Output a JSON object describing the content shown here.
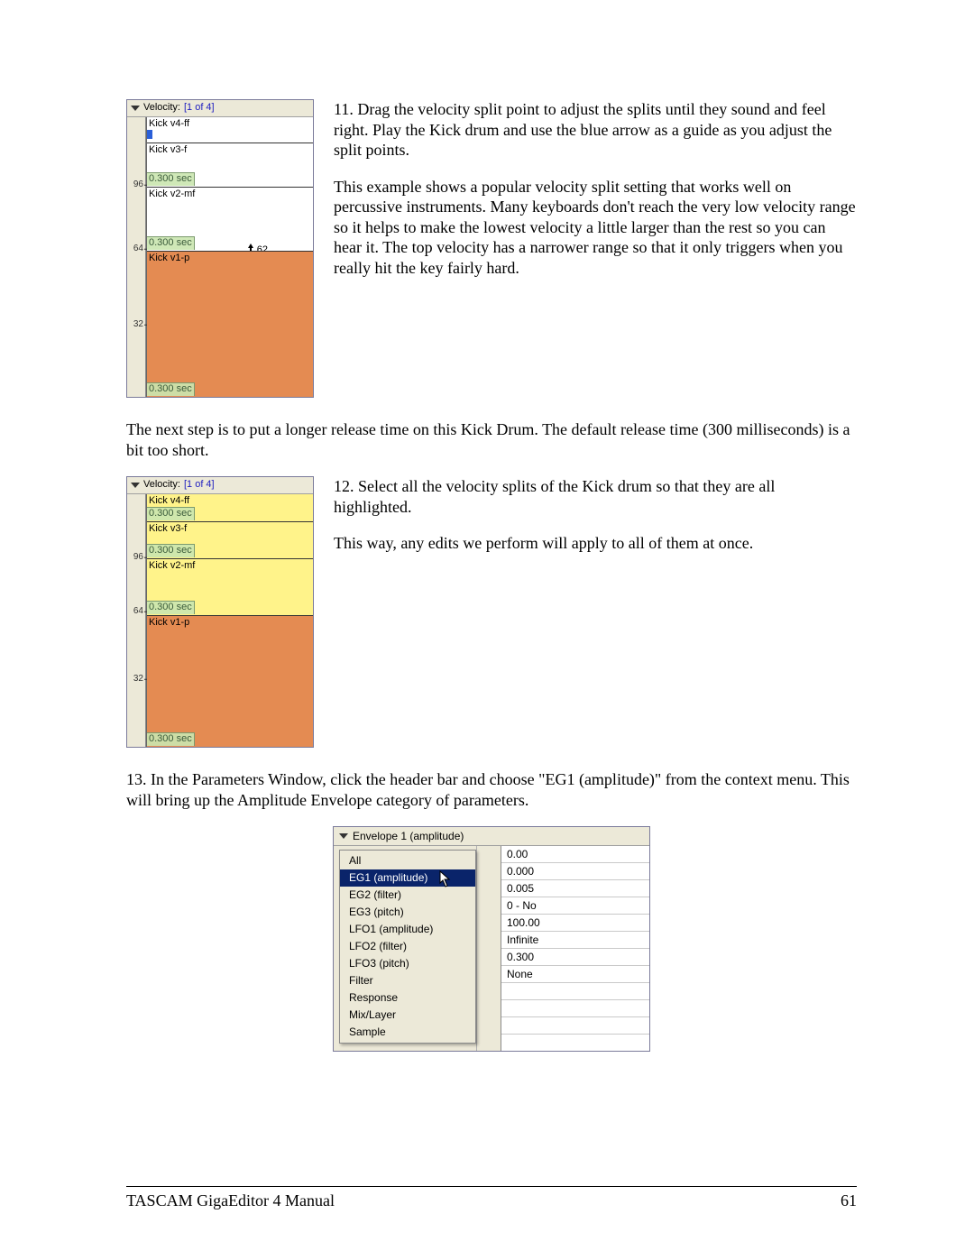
{
  "step11": {
    "text1": "11. Drag the velocity split point to adjust the splits until they sound and feel right.  Play the Kick drum and use the blue arrow as a guide as you adjust the split points.",
    "text2": "This example shows a popular velocity split setting that works well on percussive instruments.  Many keyboards don't reach the very low velocity range so it helps to make the lowest velocity a little larger than the rest so you can hear it.  The top velocity has a narrower range so that it only triggers when you really hit the key fairly hard."
  },
  "midtext": "The next step is to put a longer release time on this Kick Drum.  The default release time (300 milliseconds) is a bit too short.",
  "step12": {
    "text1": "12. Select all the velocity splits of the Kick drum so that they are all highlighted.",
    "text2": "This way, any edits we perform will apply to all of them at once."
  },
  "step13": "13. In the Parameters Window, click the header bar and choose \"EG1 (amplitude)\" from the context menu.  This will bring up the Amplitude Envelope category of parameters.",
  "velocity": {
    "title_label": "Velocity:",
    "title_count": "[1 of 4]",
    "ticks": {
      "t96": "96",
      "t64": "64",
      "t32": "32"
    },
    "drag_value": "62",
    "splits": [
      {
        "name": "Kick v4-ff",
        "rel": "0.300 sec"
      },
      {
        "name": "Kick v3-f",
        "rel": "0.300 sec"
      },
      {
        "name": "Kick v2-mf",
        "rel": "0.300 sec"
      },
      {
        "name": "Kick v1-p",
        "rel": "0.300 sec"
      }
    ]
  },
  "params": {
    "header": "Envelope 1 (amplitude)",
    "menu": [
      "All",
      "EG1 (amplitude)",
      "EG2 (filter)",
      "EG3 (pitch)",
      "LFO1 (amplitude)",
      "LFO2 (filter)",
      "LFO3 (pitch)",
      "Filter",
      "Response",
      "Mix/Layer",
      "Sample"
    ],
    "selected_index": 1,
    "values": [
      "0.00",
      "0.000",
      "0.005",
      "0 - No",
      "100.00",
      "Infinite",
      "0.300",
      "None",
      "",
      "",
      ""
    ]
  },
  "footer": {
    "left": "TASCAM GigaEditor 4 Manual",
    "right": "61"
  }
}
